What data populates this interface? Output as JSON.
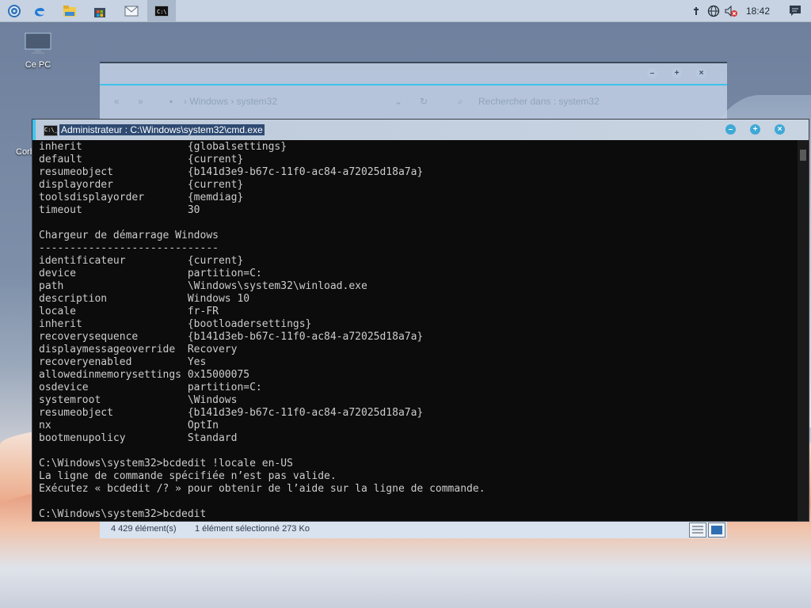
{
  "taskbar": {
    "apps": [
      {
        "name": "start-button"
      },
      {
        "name": "edge-icon"
      },
      {
        "name": "file-explorer-icon"
      },
      {
        "name": "store-icon"
      },
      {
        "name": "mail-icon"
      },
      {
        "name": "cmd-icon"
      }
    ],
    "clock": "18:42"
  },
  "desktop": {
    "this_pc_label": "Ce PC",
    "recycle_label": "Corb"
  },
  "explorer": {
    "nav_path": "›  Windows  ›  system32",
    "search_placeholder": "Rechercher dans : system32",
    "status_items": "4 429 élément(s)",
    "status_selected": "1 élément sélectionné  273 Ko"
  },
  "cmd": {
    "title": "Administrateur : C:\\Windows\\system32\\cmd.exe",
    "icon_text": "C:\\_",
    "lines": [
      "inherit                 {globalsettings}",
      "default                 {current}",
      "resumeobject            {b141d3e9-b67c-11f0-ac84-a72025d18a7a}",
      "displayorder            {current}",
      "toolsdisplayorder       {memdiag}",
      "timeout                 30",
      "",
      "Chargeur de démarrage Windows",
      "-----------------------------",
      "identificateur          {current}",
      "device                  partition=C:",
      "path                    \\Windows\\system32\\winload.exe",
      "description             Windows 10",
      "locale                  fr-FR",
      "inherit                 {bootloadersettings}",
      "recoverysequence        {b141d3eb-b67c-11f0-ac84-a72025d18a7a}",
      "displaymessageoverride  Recovery",
      "recoveryenabled         Yes",
      "allowedinmemorysettings 0x15000075",
      "osdevice                partition=C:",
      "systemroot              \\Windows",
      "resumeobject            {b141d3e9-b67c-11f0-ac84-a72025d18a7a}",
      "nx                      OptIn",
      "bootmenupolicy          Standard",
      "",
      "C:\\Windows\\system32>bcdedit !locale en-US",
      "La ligne de commande spécifiée n’est pas valide.",
      "Exécutez « bcdedit /? » pour obtenir de l’aide sur la ligne de commande.",
      ""
    ],
    "prompt": "C:\\Windows\\system32>bcdedit"
  }
}
